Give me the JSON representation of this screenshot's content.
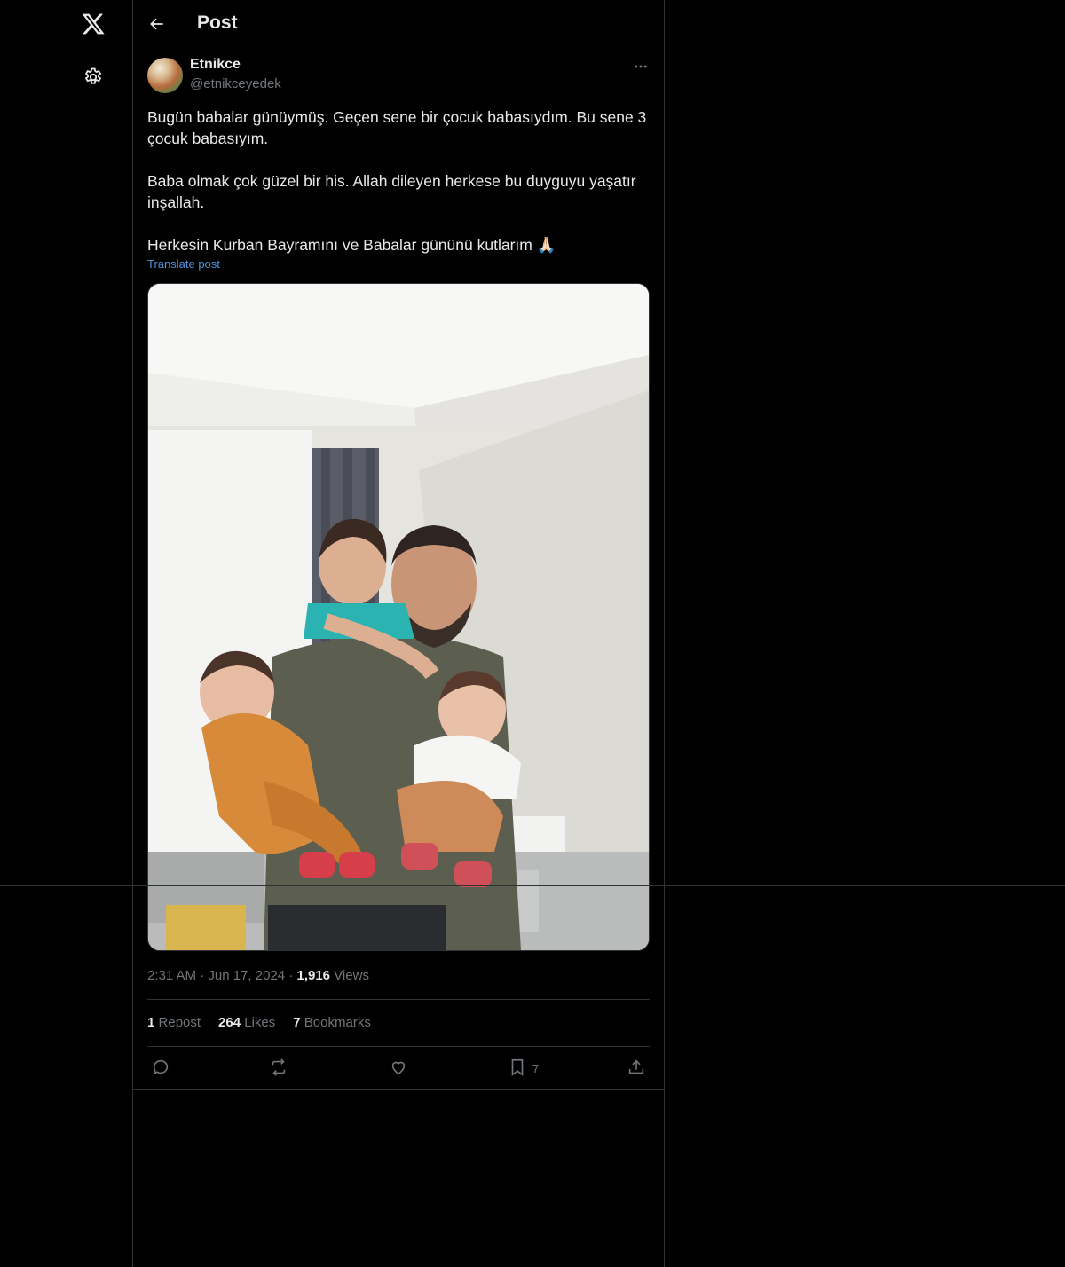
{
  "nav": {
    "logo_icon": "x-logo-icon",
    "settings_icon": "gear-icon"
  },
  "header": {
    "back_icon": "arrow-left-icon",
    "title": "Post"
  },
  "post": {
    "author_name": "Etnikce",
    "author_handle": "@etnikceyedek",
    "more_icon": "ellipsis-icon",
    "text": {
      "paragraph1": "Bugün babalar günüymüş. Geçen sene bir çocuk babasıydım. Bu sene 3 çocuk babasıyım.",
      "paragraph2": "Baba olmak çok güzel bir his. Allah dileyen herkese bu duyguyu yaşatır inşallah.",
      "paragraph3": "Herkesin Kurban Bayramını ve Babalar gününü kutlarım 🙏🏻"
    },
    "translate_label": "Translate post",
    "media_alt": "",
    "time": "2:31 AM",
    "dot": "·",
    "date": "Jun 17, 2024",
    "views_count": "1,916",
    "views_label": "Views",
    "reposts_count": "1",
    "reposts_label": "Repost",
    "likes_count": "264",
    "likes_label": "Likes",
    "bookmarks_count": "7",
    "bookmarks_label": "Bookmarks",
    "bookmark_action_count": "7"
  },
  "colors": {
    "background": "#000000",
    "text": "#e7e9ea",
    "muted": "#71767b",
    "border": "#2f3336",
    "link": "#4a94d9"
  }
}
